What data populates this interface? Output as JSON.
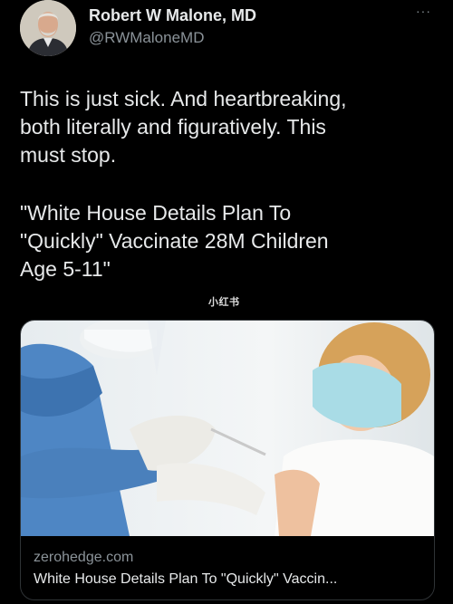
{
  "author": {
    "name": "Robert W Malone, MD",
    "handle": "@RWMaloneMD",
    "avatar_icon": "profile-photo"
  },
  "menu": {
    "more_label": "···"
  },
  "tweet": {
    "text": "This is just sick.  And heartbreaking,\nboth literally and figuratively. This\nmust stop.",
    "quote": "\"White House Details Plan To\n\"Quickly\" Vaccinate 28M Children\nAge 5-11\""
  },
  "watermark": "小红书",
  "link_card": {
    "image_icon": "child-vaccination-photo",
    "domain": "zerohedge.com",
    "title": "White House Details Plan To \"Quickly\" Vaccin..."
  }
}
